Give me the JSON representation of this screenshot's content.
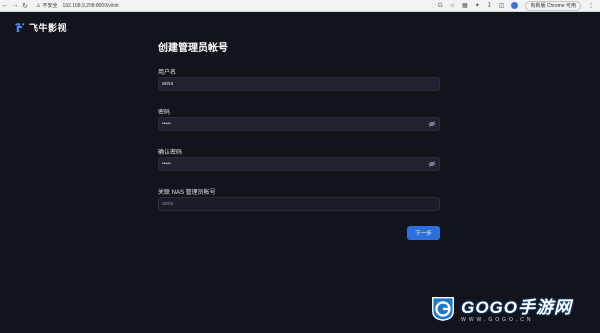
{
  "browser": {
    "insecure_label": "不安全",
    "url": "192.168.9.208:8000/v/init",
    "update_label": "有新版 Chrome 可用"
  },
  "app": {
    "title": "飞牛影视"
  },
  "form": {
    "title": "创建管理员帐号",
    "username_label": "用户名",
    "username_value": "anna",
    "password_label": "密码",
    "password_value": "•••••",
    "confirm_label": "确认密码",
    "confirm_value": "•••••",
    "nas_label": "关联 NAS 管理员帐号",
    "nas_value": "anna",
    "next_label": "下一步"
  },
  "watermark": {
    "main": "GOGO手游网",
    "sub": "WWW.GOGO.CN"
  },
  "colors": {
    "background": "#12141c",
    "field": "#1f2230",
    "accent": "#2f6fd9"
  }
}
